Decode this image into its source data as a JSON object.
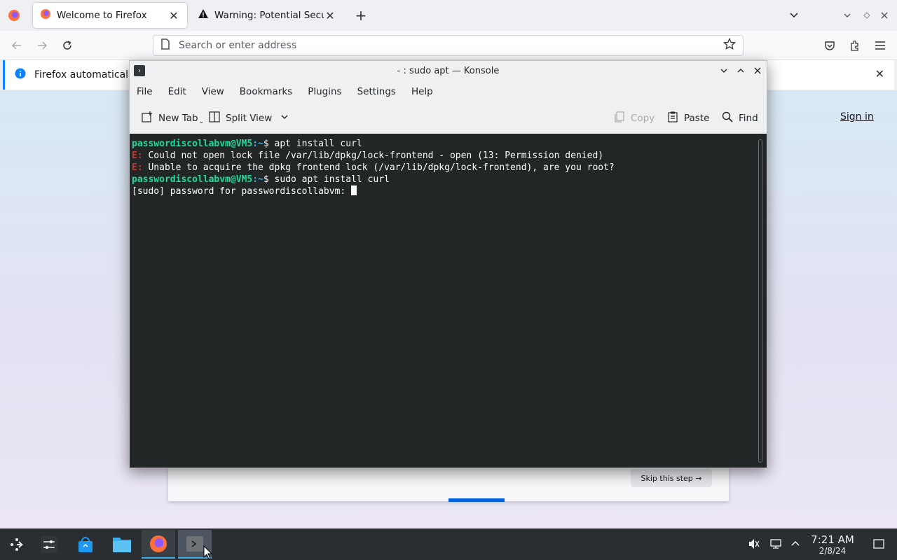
{
  "firefox": {
    "tabs": [
      {
        "title": "Welcome to Firefox",
        "icon": "firefox-icon"
      },
      {
        "title": "Warning: Potential Security Risk Ahead",
        "icon": "warning-icon"
      }
    ],
    "url_placeholder": "Search or enter address",
    "notice_text": "Firefox automatically s",
    "sign_in": "Sign in",
    "skip_step": "Skip this step →",
    "onboarding_progress": 0.1
  },
  "konsole": {
    "title": "- : sudo apt — Konsole",
    "menu": [
      "File",
      "Edit",
      "View",
      "Bookmarks",
      "Plugins",
      "Settings",
      "Help"
    ],
    "toolbar": {
      "new_tab": "New Tab",
      "split_view": "Split View",
      "copy": "Copy",
      "paste": "Paste",
      "find": "Find"
    },
    "terminal": {
      "user_host": "passwordiscollabvm@VM5",
      "path": ":~",
      "line1_cmd": "$ apt install curl",
      "err_prefix": "E:",
      "err1": " Could not open lock file /var/lib/dpkg/lock-frontend - open (13: Permission denied)",
      "err2": " Unable to acquire the dpkg frontend lock (/var/lib/dpkg/lock-frontend), are you root?",
      "line4_cmd": "$ sudo apt install curl",
      "sudo_prompt": "[sudo] password for passwordiscollabvm: "
    }
  },
  "taskbar": {
    "time": "7:21 AM",
    "date": "2/8/24"
  },
  "colors": {
    "terminal_bg": "#232627",
    "prompt_user": "#1cdc9a",
    "error": "#c0392b",
    "accent": "#3daee9"
  }
}
